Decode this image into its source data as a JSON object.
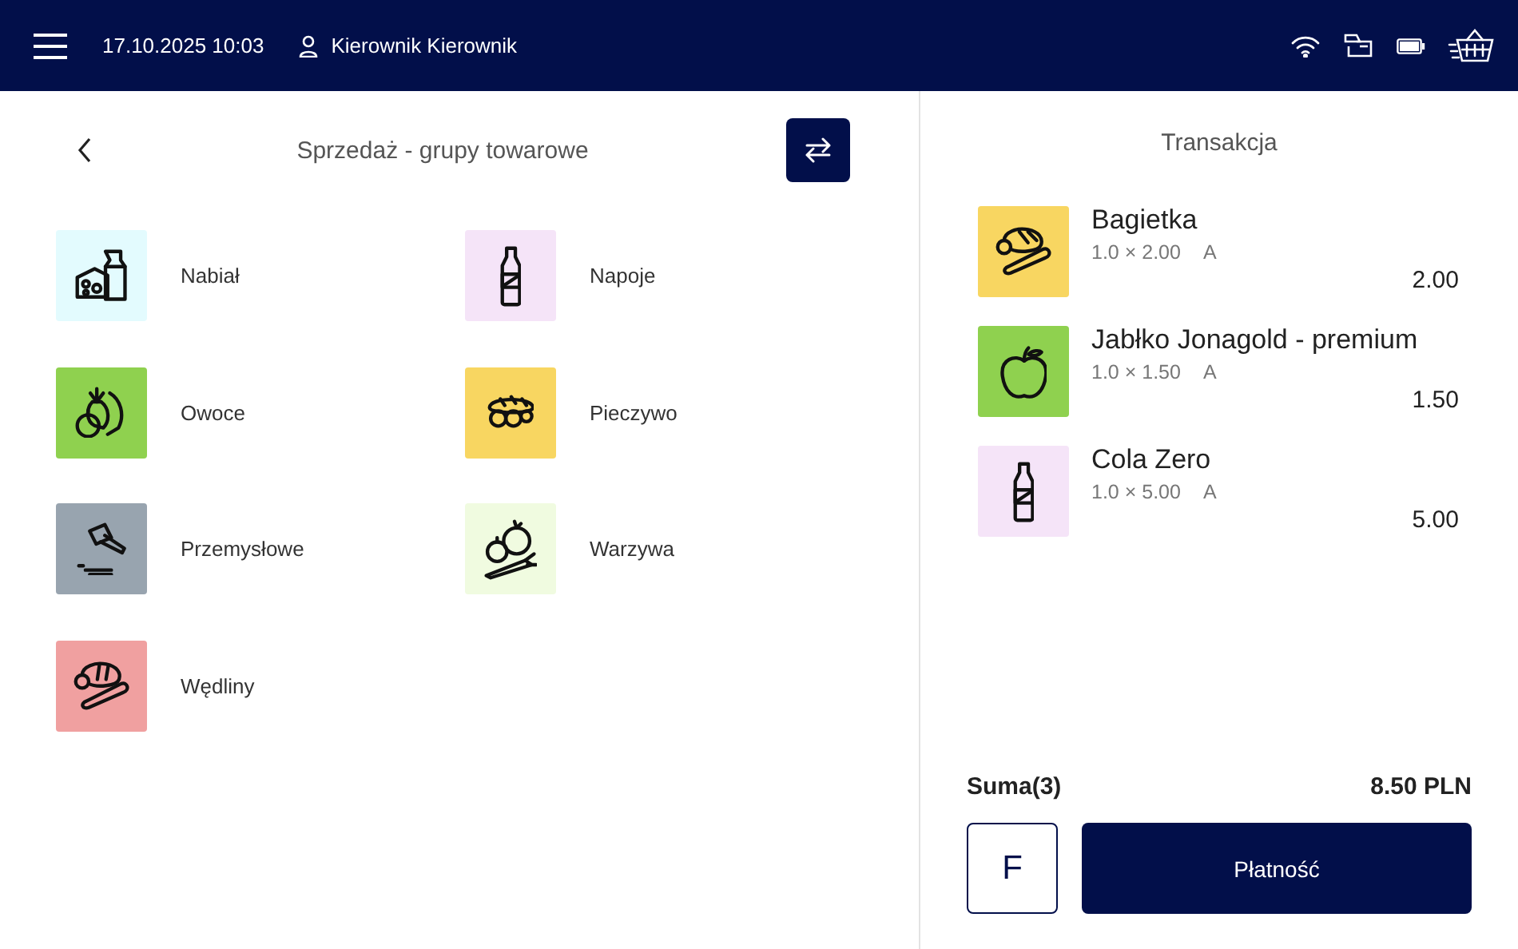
{
  "header": {
    "datetime": "17.10.2025 10:03",
    "user": "Kierownik Kierownik"
  },
  "groups_panel": {
    "title": "Sprzedaż - grupy towarowe",
    "categories": [
      {
        "label": "Nabiał",
        "kind": "dairy",
        "color": "#e3fbfe"
      },
      {
        "label": "Napoje",
        "kind": "drink",
        "color": "#f5e4f8"
      },
      {
        "label": "Owoce",
        "kind": "fruit",
        "color": "#8fd14f"
      },
      {
        "label": "Pieczywo",
        "kind": "bread",
        "color": "#f8d661"
      },
      {
        "label": "Przemysłowe",
        "kind": "industrial",
        "color": "#98a4af"
      },
      {
        "label": "Warzywa",
        "kind": "vegetables",
        "color": "#f0fbe0"
      },
      {
        "label": "Wędliny",
        "kind": "meat",
        "color": "#f0a0a0"
      }
    ]
  },
  "transaction": {
    "title": "Transakcja",
    "items": [
      {
        "name": "Bagietka",
        "quantity": "1.0 × 2.00",
        "vat": "A",
        "price": "2.00",
        "kind": "baguette",
        "color": "#f8d661"
      },
      {
        "name": "Jabłko Jonagold - premium",
        "quantity": "1.0 × 1.50",
        "vat": "A",
        "price": "1.50",
        "kind": "apple",
        "color": "#8fd14f"
      },
      {
        "name": "Cola Zero",
        "quantity": "1.0 × 5.00",
        "vat": "A",
        "price": "5.00",
        "kind": "drink",
        "color": "#f5e4f8"
      }
    ],
    "sum_label": "Suma(3)",
    "sum_value": "8.50 PLN",
    "f_button": "F",
    "pay_button": "Płatność"
  }
}
